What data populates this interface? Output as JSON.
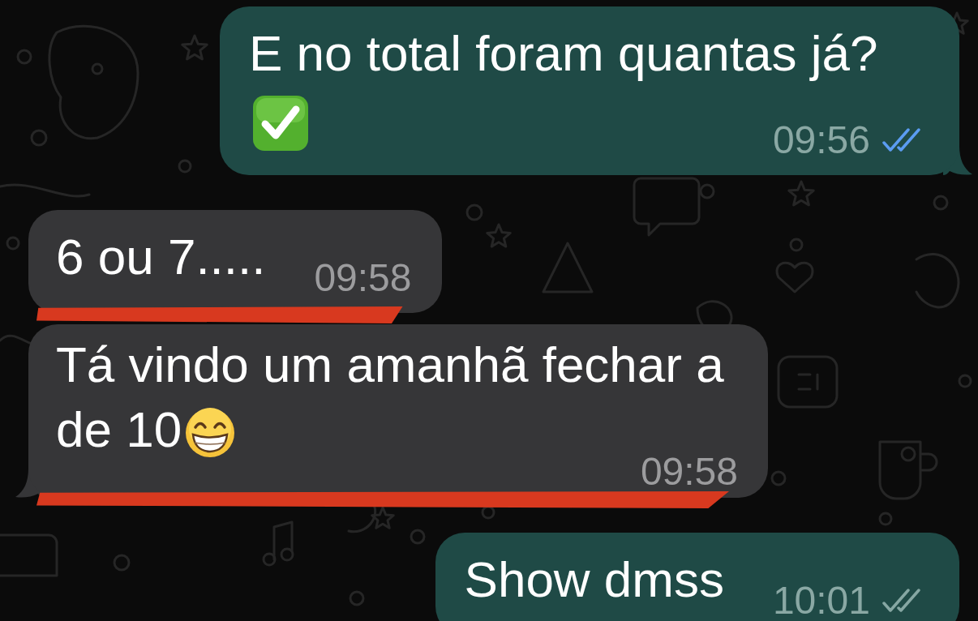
{
  "messages": [
    {
      "kind": "outgoing",
      "text": "E no total foram quantas já?",
      "emoji": {
        "kind": "check_mark"
      },
      "time": "09:56",
      "read": true,
      "tail": true,
      "underlined": false
    },
    {
      "kind": "incoming",
      "text": "6 ou 7.....",
      "time": "09:58",
      "tail": false,
      "underlined": true
    },
    {
      "kind": "incoming",
      "text": "Tá vindo um amanhã fechar a de 10",
      "emoji": {
        "kind": "grinning_face"
      },
      "time": "09:58",
      "tail": true,
      "underlined": true
    },
    {
      "kind": "outgoing",
      "text": "Show dmss",
      "time": "10:01",
      "read": false,
      "tail": false,
      "underlined": false
    }
  ]
}
